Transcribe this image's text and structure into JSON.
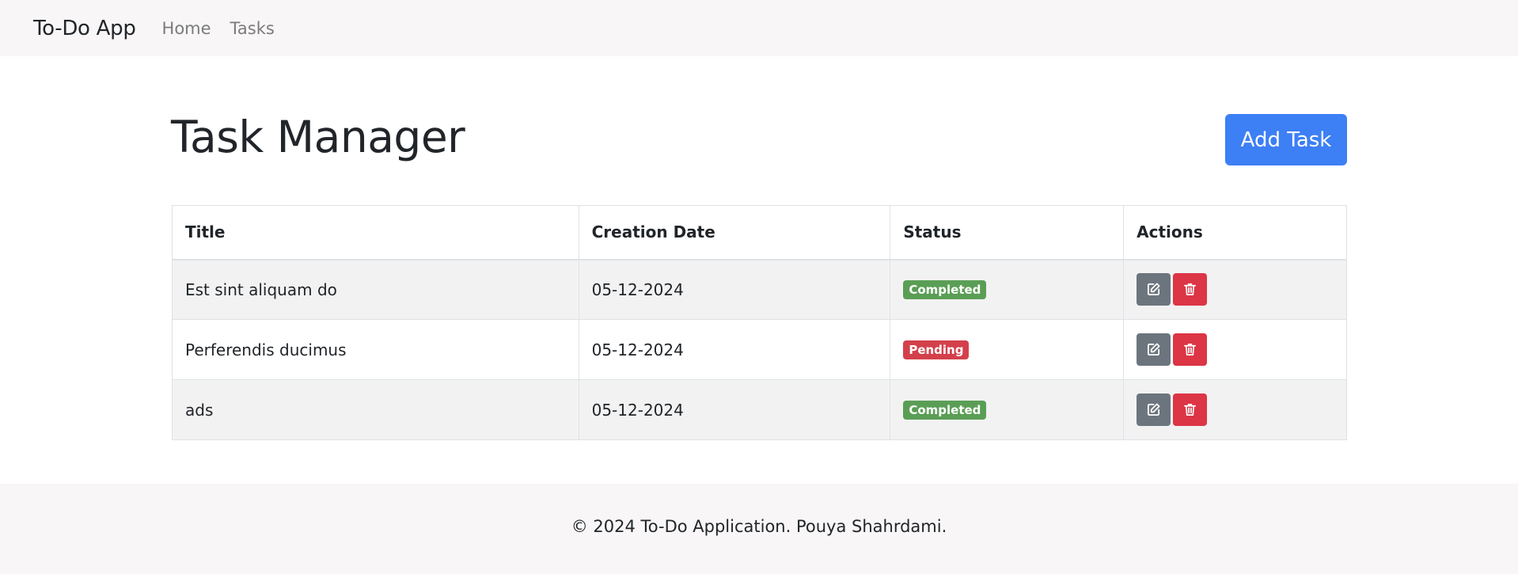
{
  "navbar": {
    "brand": "To-Do App",
    "links": [
      {
        "label": "Home"
      },
      {
        "label": "Tasks"
      }
    ]
  },
  "header": {
    "title": "Task Manager",
    "add_button_label": "Add Task"
  },
  "table": {
    "columns": [
      "Title",
      "Creation Date",
      "Status",
      "Actions"
    ],
    "rows": [
      {
        "title": "Est sint aliquam do",
        "date": "05-12-2024",
        "status": "Completed"
      },
      {
        "title": "Perferendis ducimus",
        "date": "05-12-2024",
        "status": "Pending"
      },
      {
        "title": "ads",
        "date": "05-12-2024",
        "status": "Completed"
      }
    ]
  },
  "status_colors": {
    "Completed": "#5a9e55",
    "Pending": "#d3404b"
  },
  "icons": {
    "edit": "edit-icon",
    "delete": "trash-icon"
  },
  "colors": {
    "accent": "#3d7ff5",
    "edit_button": "#6c757d",
    "delete_button": "#dc3545"
  },
  "footer": {
    "text": "© 2024 To-Do Application. Pouya Shahrdami."
  }
}
